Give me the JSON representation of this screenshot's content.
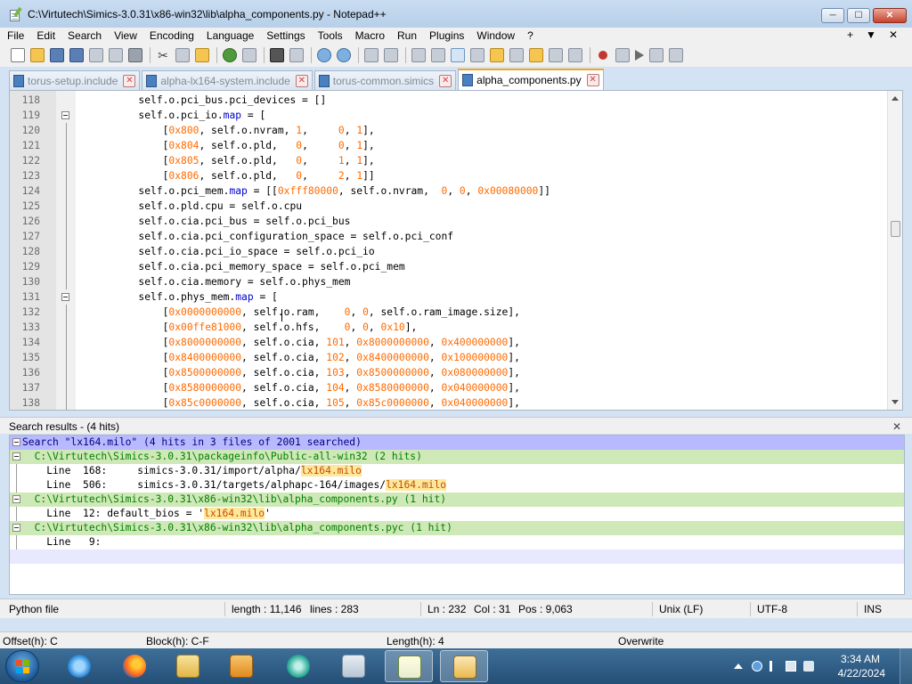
{
  "window": {
    "title": "C:\\Virtutech\\Simics-3.0.31\\x86-win32\\lib\\alpha_components.py - Notepad++",
    "minimize": "─",
    "maximize": "☐",
    "close": "✕"
  },
  "menu": {
    "items": [
      "File",
      "Edit",
      "Search",
      "View",
      "Encoding",
      "Language",
      "Settings",
      "Tools",
      "Macro",
      "Run",
      "Plugins",
      "Window",
      "?"
    ],
    "right": [
      "+",
      "▼",
      "✕"
    ]
  },
  "tabs": [
    {
      "label": "torus-setup.include",
      "active": false
    },
    {
      "label": "alpha-lx164-system.include",
      "active": false
    },
    {
      "label": "torus-common.simics",
      "active": false
    },
    {
      "label": "alpha_components.py",
      "active": true
    }
  ],
  "editor": {
    "lines": [
      {
        "n": "118",
        "code": "self.o.pci_bus.pci_devices = []"
      },
      {
        "n": "119",
        "code": "self.o.pci_io.map = [",
        "fold": true
      },
      {
        "n": "120",
        "code": "    [0x800, self.o.nvram, 1,     0, 1],"
      },
      {
        "n": "121",
        "code": "    [0x804, self.o.pld,   0,     0, 1],"
      },
      {
        "n": "122",
        "code": "    [0x805, self.o.pld,   0,     1, 1],"
      },
      {
        "n": "123",
        "code": "    [0x806, self.o.pld,   0,     2, 1]]"
      },
      {
        "n": "124",
        "code": "self.o.pci_mem.map = [[0xfff80000, self.o.nvram,  0, 0, 0x00080000]]"
      },
      {
        "n": "125",
        "code": "self.o.pld.cpu = self.o.cpu"
      },
      {
        "n": "126",
        "code": "self.o.cia.pci_bus = self.o.pci_bus"
      },
      {
        "n": "127",
        "code": "self.o.cia.pci_configuration_space = self.o.pci_conf"
      },
      {
        "n": "128",
        "code": "self.o.cia.pci_io_space = self.o.pci_io"
      },
      {
        "n": "129",
        "code": "self.o.cia.pci_memory_space = self.o.pci_mem"
      },
      {
        "n": "130",
        "code": "self.o.cia.memory = self.o.phys_mem"
      },
      {
        "n": "131",
        "code": "self.o.phys_mem.map = [",
        "fold": true
      },
      {
        "n": "132",
        "code": "    [0x0000000000, self.o.ram,    0, 0, self.o.ram_image.size],"
      },
      {
        "n": "133",
        "code": "    [0x00ffe81000, self.o.hfs,    0, 0, 0x10],"
      },
      {
        "n": "134",
        "code": "    [0x8000000000, self.o.cia, 101, 0x8000000000, 0x400000000],"
      },
      {
        "n": "135",
        "code": "    [0x8400000000, self.o.cia, 102, 0x8400000000, 0x100000000],"
      },
      {
        "n": "136",
        "code": "    [0x8500000000, self.o.cia, 103, 0x8500000000, 0x080000000],"
      },
      {
        "n": "137",
        "code": "    [0x8580000000, self.o.cia, 104, 0x8580000000, 0x040000000],"
      },
      {
        "n": "138",
        "code": "    [0x85c0000000, self.o.cia, 105, 0x85c0000000, 0x040000000],"
      }
    ]
  },
  "search": {
    "title": "Search results - (4 hits)",
    "close": "✕",
    "results": [
      {
        "type": "head",
        "text": "Search \"lx164.milo\" (4 hits in 3 files of 2001 searched)"
      },
      {
        "type": "file",
        "text": "  C:\\Virtutech\\Simics-3.0.31\\packageinfo\\Public-all-win32 (2 hits)"
      },
      {
        "type": "line",
        "pre": "    Line  168:     simics-3.0.31/import/alpha/",
        "hit": "lx164.milo",
        "post": ""
      },
      {
        "type": "line",
        "pre": "    Line  506:     simics-3.0.31/targets/alphapc-164/images/",
        "hit": "lx164.milo",
        "post": ""
      },
      {
        "type": "file",
        "text": "  C:\\Virtutech\\Simics-3.0.31\\x86-win32\\lib\\alpha_components.py (1 hit)"
      },
      {
        "type": "line",
        "pre": "    Line  12: default_bios = '",
        "hit": "lx164.milo",
        "post": "'"
      },
      {
        "type": "file",
        "text": "  C:\\Virtutech\\Simics-3.0.31\\x86-win32\\lib\\alpha_components.pyc (1 hit)"
      },
      {
        "type": "line",
        "pre": "    Line   9:",
        "hit": "",
        "post": ""
      },
      {
        "type": "empty",
        "text": ""
      }
    ]
  },
  "status": {
    "filetype": "Python file",
    "length": "length : 11,146",
    "lines": "lines : 283",
    "ln": "Ln : 232",
    "col": "Col : 31",
    "pos": "Pos : 9,063",
    "eol": "Unix (LF)",
    "encoding": "UTF-8",
    "mode": "INS"
  },
  "hexbar": {
    "offset": "Offset(h): C",
    "block": "Block(h): C-F",
    "length": "Length(h): 4",
    "mode": "Overwrite"
  },
  "taskbar": {
    "apps": [
      "start-menu",
      "internet-explorer",
      "firefox",
      "file-explorer",
      "media-player",
      "app-circle",
      "app-wave",
      "notepad-plus-plus",
      "hxd-hex-editor"
    ],
    "time": "3:34 AM",
    "date": "4/22/2024"
  },
  "colors": {
    "keyword": "#0000d0",
    "number": "#ff6a00",
    "search_head_bg": "#b9b9ff",
    "search_file_bg": "#cfe8b7",
    "hit_bg": "#ffe79c",
    "active_tab_accent": "#f4a62a"
  }
}
